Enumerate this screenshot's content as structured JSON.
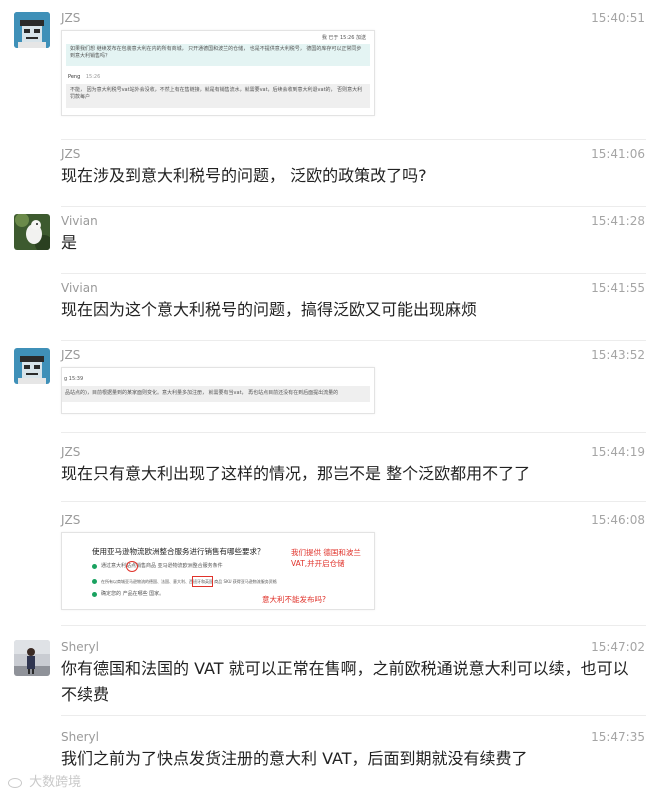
{
  "messages": [
    {
      "sender": "JZS",
      "time": "15:40:51",
      "screenshot": {
        "header_meta": "我  已于 15:26 加送",
        "quoted_text": "如果我们想 继续发布在包装意大利在内的所有商城， 只开通德国和波兰的仓储， 也是不提供意大利税号， 德国的库存可以正常同步到意大利销售吗？",
        "reply_name": "Peng",
        "reply_time": "15:26",
        "reply_text": "不能， 因为意大利税号vat站外会没收，不然上有在售链接，就是有销售流水，就需要vat，后续会收到意大利退vat的， 否则意大利罚款每户"
      }
    },
    {
      "sender": "JZS",
      "time": "15:41:06",
      "text": "现在涉及到意大利税号的问题， 泛欧的政策改了吗?"
    },
    {
      "sender": "Vivian",
      "time": "15:41:28",
      "text": "是"
    },
    {
      "sender": "Vivian",
      "time": "15:41:55",
      "text": "现在因为这个意大利税号的问题，搞得泛欧又可能出现麻烦"
    },
    {
      "sender": "JZS",
      "time": "15:43:52",
      "screenshot": {
        "header_meta": "g  15:39",
        "body_text": "品站点的)，目前根据量到的某家面则变化。意大利量多加注册， 就需要有当vat， 再也站点目前还没有在到后面提出流量的"
      }
    },
    {
      "sender": "JZS",
      "time": "15:44:19",
      "text": "现在只有意大利出现了这样的情况，那岂不是 整个泛欧都用不了了"
    },
    {
      "sender": "JZS",
      "time": "15:46:08",
      "screenshot": {
        "title": "使用亚马逊物流欧洲整合服务进行销售有哪些要求？",
        "items": [
          "通过意大利站点销售商品 亚马逊物流欧洲整合服务条件",
          "在所有以商城亚马逊物流的德国、法国、意大利、西班牙和英国  商品 SKU 获得亚马逊物流服务资格",
          "确定您的 产品在哪些 国家。"
        ],
        "highlight_a": "意大利",
        "highlight_b": "意大利",
        "note_top": "我们提供 德国和波兰VAT,并开启仓储",
        "note_bottom": "意大利不能发布吗?"
      }
    },
    {
      "sender": "Sheryl",
      "time": "15:47:02",
      "text": "你有德国和法国的 VAT 就可以正常在售啊，之前欧税通说意大利可以续，也可以不续费"
    },
    {
      "sender": "Sheryl",
      "time": "15:47:35",
      "text": "我们之前为了快点发货注册的意大利 VAT，后面到期就没有续费了"
    }
  ],
  "watermark": "大数跨境",
  "colors": {
    "annotation_red": "#e0332b",
    "check_green": "#1aa260",
    "divider": "#ececec"
  }
}
